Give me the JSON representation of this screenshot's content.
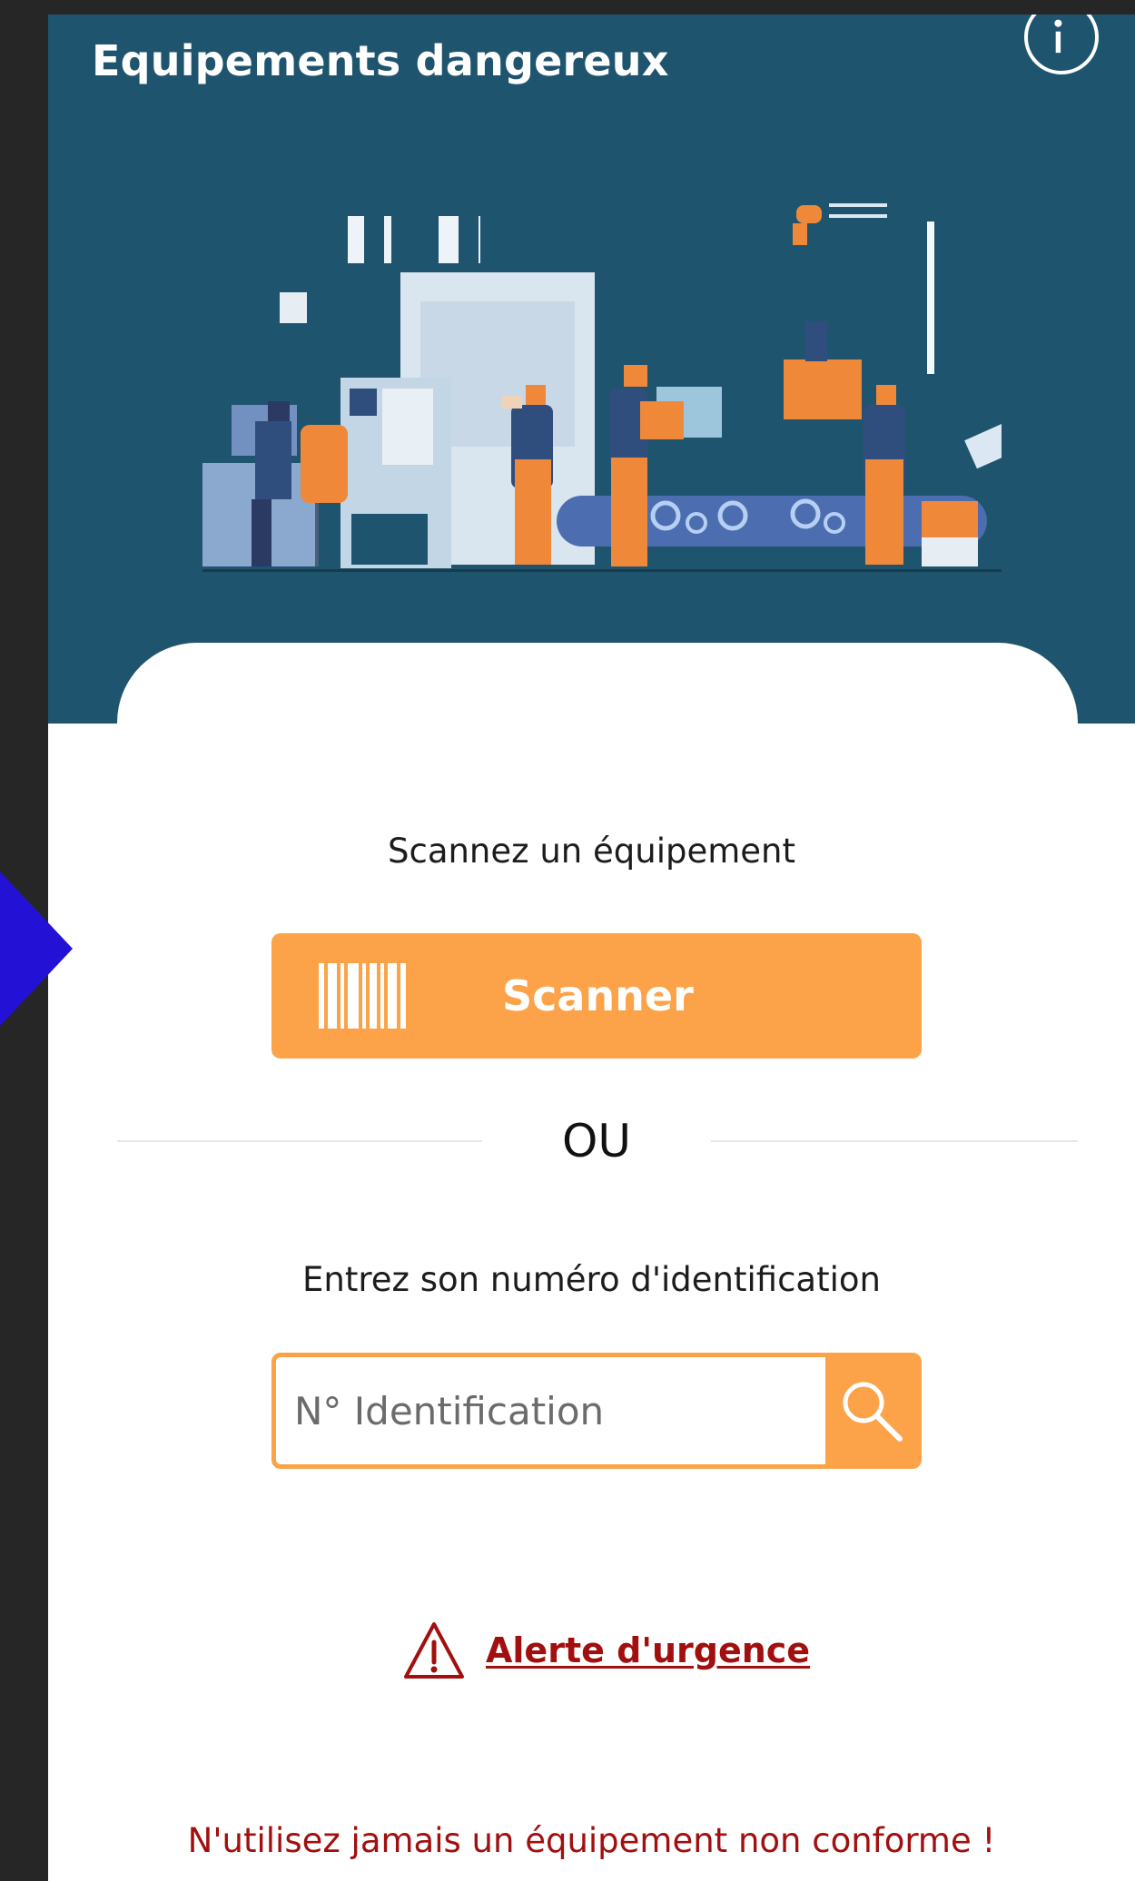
{
  "app": {
    "title": "Equipements dangereux",
    "info_icon": "info-icon",
    "illustration": "factory-workers-illustration"
  },
  "scan": {
    "label": "Scannez un équipement",
    "button_label": "Scanner",
    "button_icon": "barcode-icon"
  },
  "divider": {
    "text": "OU"
  },
  "identification": {
    "label": "Entrez son numéro d'identification",
    "placeholder": "N° Identification",
    "value": "",
    "search_icon": "search-icon"
  },
  "alert": {
    "label": "Alerte d'urgence",
    "icon": "warning-triangle-icon"
  },
  "footer": {
    "warning": "N'utilisez jamais un équipement non conforme !"
  },
  "colors": {
    "header_bg": "#1f546e",
    "accent": "#fca349",
    "alert": "#a10f0f",
    "left_arrow": "#2411d6"
  }
}
